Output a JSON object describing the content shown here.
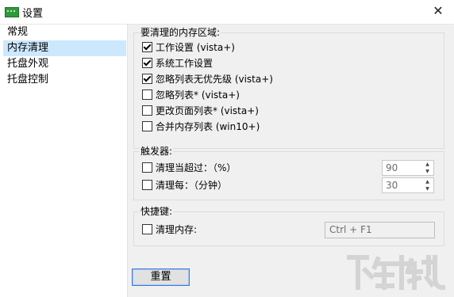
{
  "window": {
    "title": "设置",
    "close_glyph": "✕"
  },
  "sidebar": {
    "items": [
      {
        "label": "常规",
        "selected": false
      },
      {
        "label": "内存清理",
        "selected": true
      },
      {
        "label": "托盘外观",
        "selected": false
      },
      {
        "label": "托盘控制",
        "selected": false
      }
    ]
  },
  "memory_area": {
    "title": "要清理的内存区域:",
    "options": [
      {
        "label": "工作设置 (vista+)",
        "checked": true
      },
      {
        "label": "系统工作设置",
        "checked": true
      },
      {
        "label": "忽略列表无优先级 (vista+)",
        "checked": true
      },
      {
        "label": "忽略列表* (vista+)",
        "checked": false
      },
      {
        "label": "更改页面列表* (vista+)",
        "checked": false
      },
      {
        "label": "合并内存列表 (win10+)",
        "checked": false
      }
    ]
  },
  "trigger": {
    "title": "触发器:",
    "rows": [
      {
        "label": "清理当超过：（%）",
        "checked": false,
        "value": "90"
      },
      {
        "label": "清理每：（分钟）",
        "checked": false,
        "value": "30"
      }
    ]
  },
  "hotkey": {
    "title": "快捷键:",
    "label": "清理内存:",
    "checked": false,
    "value": "Ctrl + F1"
  },
  "buttons": {
    "reset_label": "重置"
  },
  "colors": {
    "selection": "#cce8ff",
    "panel": "#f0f0f0",
    "button_border": "#3b7bd5"
  }
}
